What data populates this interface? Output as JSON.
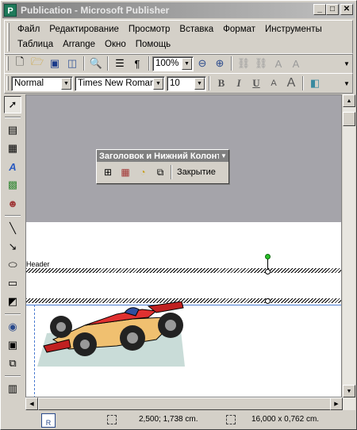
{
  "window": {
    "title": "Publication - Microsoft Publisher",
    "app_icon": "P",
    "controls": [
      "minimize",
      "maximize",
      "close"
    ]
  },
  "menu": {
    "row1": [
      "Файл",
      "Редактирование",
      "Просмотр",
      "Вставка",
      "Формат",
      "Инструменты"
    ],
    "row2": [
      "Таблица",
      "Arrange",
      "Окно",
      "Помощь"
    ]
  },
  "standard_toolbar": {
    "zoom": "100%"
  },
  "formatting_toolbar": {
    "style": "Normal",
    "font": "Times New Roman",
    "size": "10",
    "bold": "B",
    "italic": "I",
    "underline": "U"
  },
  "floating_toolbar": {
    "title": "Заголовок и Нижний Колонтитул",
    "close_label": "Закрытие"
  },
  "page": {
    "header_label": "Header"
  },
  "status": {
    "page_number": "R",
    "position": "2,500; 1,738 cm.",
    "size": "16,000 x  0,762 cm."
  },
  "colors": {
    "workspace": "#a5a4aa",
    "guide": "#4a7bd0",
    "rotation_handle": "#2bbf2b"
  }
}
